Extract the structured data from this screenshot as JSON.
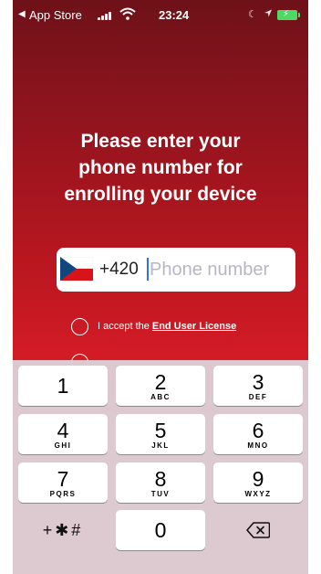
{
  "status_bar": {
    "back_indicator": "◀",
    "back_app": "App Store",
    "time": "23:24",
    "icons": [
      "signal-icon",
      "wifi-icon",
      "moon-icon",
      "location-icon",
      "battery-charging-icon"
    ],
    "battery_color": "#4cd964"
  },
  "heading": {
    "line1": "Please enter your",
    "line2": "phone number for",
    "line3": "enrolling your device"
  },
  "phone": {
    "flag": "czech-flag-icon",
    "dial_code": "+420",
    "placeholder": "Phone number",
    "value": ""
  },
  "agreements": {
    "eula_prefix": "I accept the",
    "eula_link": "End User License"
  },
  "keypad": {
    "keys": [
      {
        "num": "1",
        "letters": ""
      },
      {
        "num": "2",
        "letters": "ABC"
      },
      {
        "num": "3",
        "letters": "DEF"
      },
      {
        "num": "4",
        "letters": "GHI"
      },
      {
        "num": "5",
        "letters": "JKL"
      },
      {
        "num": "6",
        "letters": "MNO"
      },
      {
        "num": "7",
        "letters": "PQRS"
      },
      {
        "num": "8",
        "letters": "TUV"
      },
      {
        "num": "9",
        "letters": "WXYZ"
      }
    ],
    "symbols": "+✱#",
    "zero": "0",
    "delete_icon": "backspace-icon"
  },
  "colors": {
    "background_top": "#6e1118",
    "background_bottom": "#e22129",
    "caret": "#2f6dff",
    "keypad_bg": "#ddced6"
  }
}
